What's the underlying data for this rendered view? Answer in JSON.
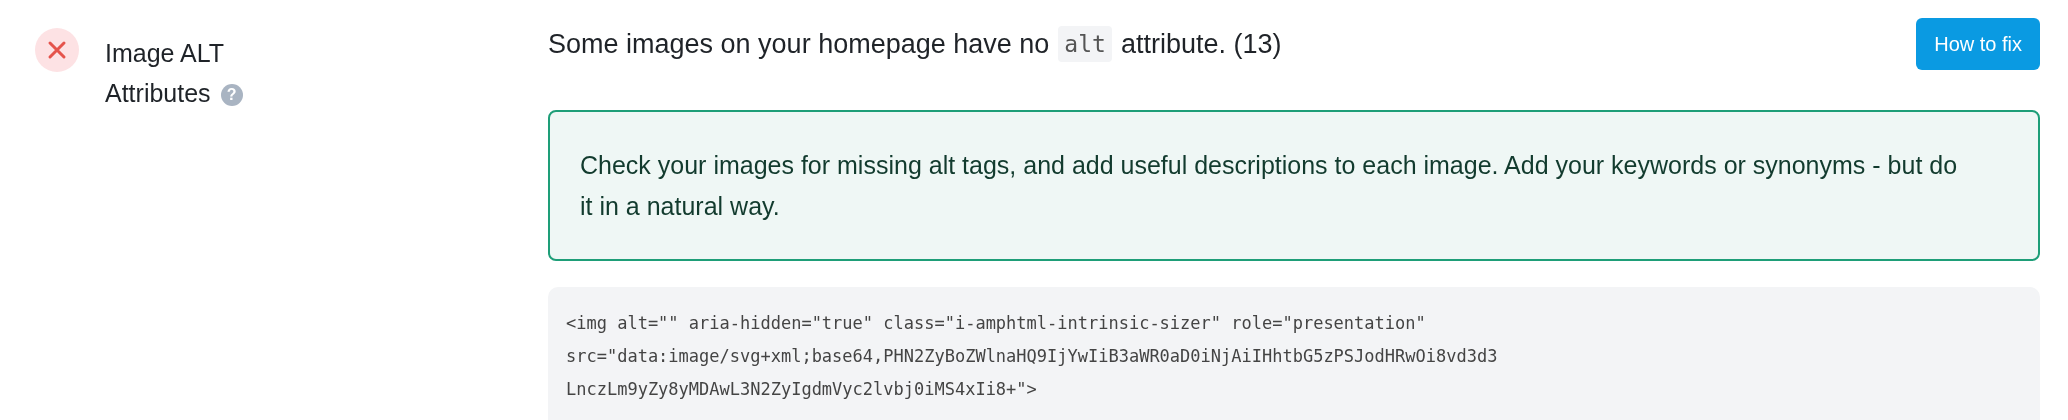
{
  "check": {
    "passed": false,
    "title": "Image ALT Attributes",
    "help": "?"
  },
  "message": {
    "before": "Some images on your homepage have no",
    "code": "alt",
    "after": "attribute. (13)"
  },
  "button": "How to fix",
  "advice": "Check your images for missing alt tags, and add useful descriptions to each image. Add your keywords or synonyms - but do it in a natural way.",
  "code_lines": [
    "<img alt=\"\" aria-hidden=\"true\" class=\"i-amphtml-intrinsic-sizer\" role=\"presentation\"",
    "src=\"data:image/svg+xml;base64,PHN2ZyBoZWlnaHQ9IjYwIiB3aWR0aD0iNjAiIHhtbG5zPSJodHRwOi8vd3d3",
    "LnczLm9yZy8yMDAwL3N2ZyIgdmVyc2lvbj0iMS4xIi8+\">"
  ]
}
